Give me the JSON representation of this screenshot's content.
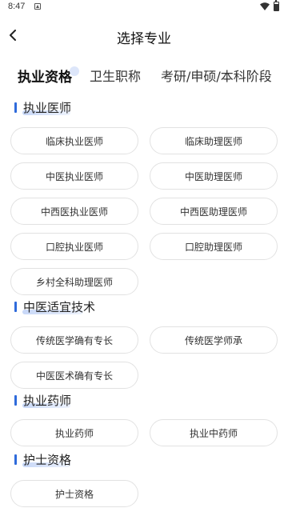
{
  "status_bar": {
    "time": "8:47"
  },
  "header": {
    "title": "选择专业"
  },
  "tabs": [
    {
      "label": "执业资格"
    },
    {
      "label": "卫生职称"
    },
    {
      "label": "考研/申硕/本科阶段"
    }
  ],
  "sections": [
    {
      "title": "执业医师",
      "items": [
        "临床执业医师",
        "临床助理医师",
        "中医执业医师",
        "中医助理医师",
        "中西医执业医师",
        "中西医助理医师",
        "口腔执业医师",
        "口腔助理医师",
        "乡村全科助理医师"
      ]
    },
    {
      "title": "中医适宜技术",
      "items": [
        "传统医学确有专长",
        "传统医学师承",
        "中医医术确有专长"
      ]
    },
    {
      "title": "执业药师",
      "items": [
        "执业药师",
        "执业中药师"
      ]
    },
    {
      "title": "护士资格",
      "items": [
        "护士资格"
      ]
    }
  ],
  "colors": {
    "accent": "#2f6bdb",
    "chip_border": "#e2e2e2"
  }
}
